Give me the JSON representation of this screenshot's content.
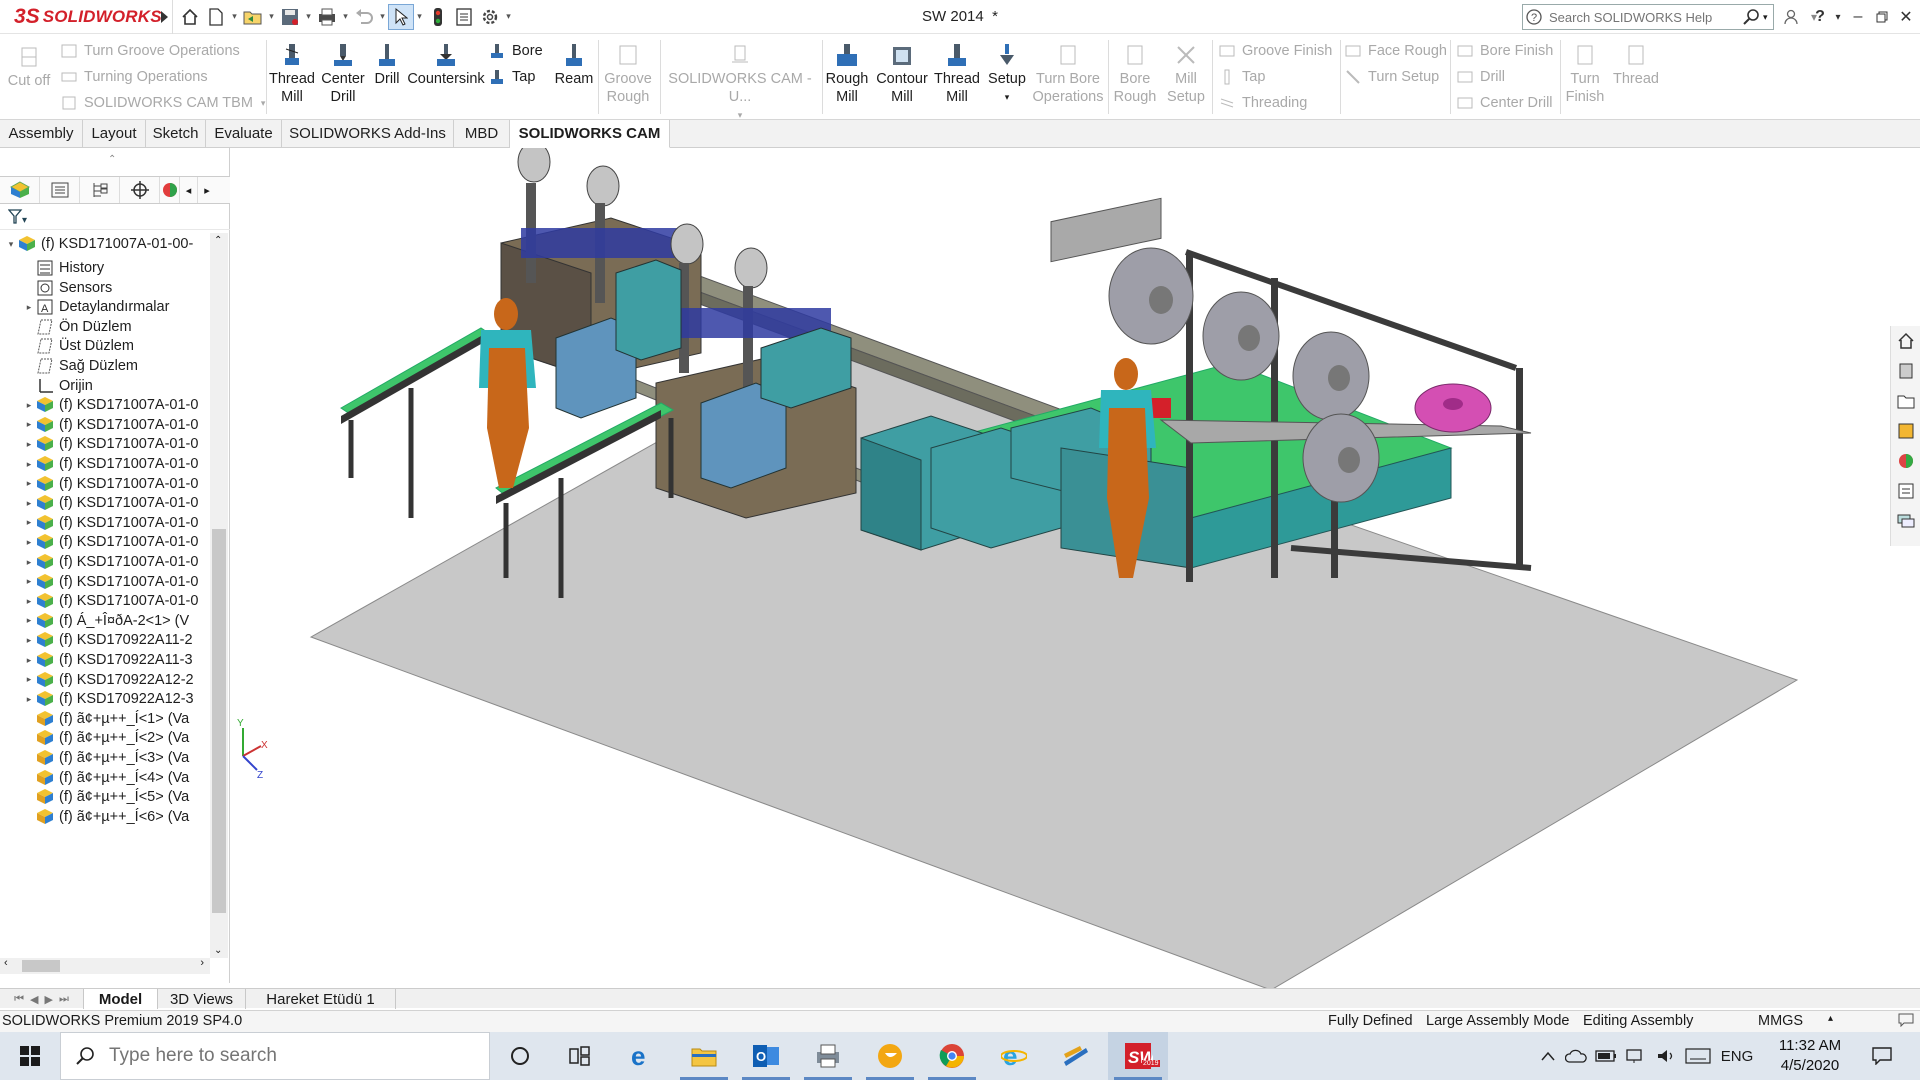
{
  "app": {
    "brand": "SOLIDWORKS",
    "document_title": "SW 2014",
    "modified_marker": "*",
    "search_placeholder": "Search SOLIDWORKS Help"
  },
  "ribbon": {
    "cut_off": "Cut off",
    "turn_groove_operations": "Turn Groove Operations",
    "turning_operations": "Turning Operations",
    "cam_tbm": "SOLIDWORKS CAM TBM",
    "thread_mill": [
      "Thread",
      "Mill"
    ],
    "center_drill": [
      "Center",
      "Drill"
    ],
    "drill": "Drill",
    "countersink": "Countersink",
    "bore": "Bore",
    "tap": "Tap",
    "ream": "Ream",
    "groove_rough": [
      "Groove",
      "Rough"
    ],
    "cam_u": "SOLIDWORKS CAM -U...",
    "rough_mill": [
      "Rough",
      "Mill"
    ],
    "contour_mill": [
      "Contour",
      "Mill"
    ],
    "thread_mill_2": [
      "Thread",
      "Mill"
    ],
    "setup": "Setup",
    "turn_bore_operations": [
      "Turn Bore",
      "Operations"
    ],
    "bore_rough": [
      "Bore",
      "Rough"
    ],
    "mill_setup": [
      "Mill",
      "Setup"
    ],
    "groove_finish": "Groove Finish",
    "tap_2": "Tap",
    "threading": "Threading",
    "face_rough": "Face Rough",
    "turn_setup": "Turn Setup",
    "bore_finish": "Bore Finish",
    "drill_2": "Drill",
    "center_drill_2": "Center Drill",
    "turn_finish": [
      "Turn",
      "Finish"
    ],
    "thread": "Thread"
  },
  "tabs": [
    "Assembly",
    "Layout",
    "Sketch",
    "Evaluate",
    "SOLIDWORKS Add-Ins",
    "MBD",
    "SOLIDWORKS CAM"
  ],
  "active_tab": "SOLIDWORKS CAM",
  "tree": {
    "root": "(f) KSD171007A-01-00-",
    "items": [
      {
        "label": "History",
        "icon": "history-icon",
        "expand": false
      },
      {
        "label": "Sensors",
        "icon": "sensors-icon",
        "expand": false
      },
      {
        "label": "Detaylandırmalar",
        "icon": "annotations-icon",
        "expand": true
      },
      {
        "label": "Ön Düzlem",
        "icon": "plane-icon",
        "expand": false
      },
      {
        "label": "Üst Düzlem",
        "icon": "plane-icon",
        "expand": false
      },
      {
        "label": "Sağ Düzlem",
        "icon": "plane-icon",
        "expand": false
      },
      {
        "label": "Orijin",
        "icon": "origin-icon",
        "expand": false
      },
      {
        "label": "(f) KSD171007A-01-0",
        "icon": "subassembly-icon",
        "expand": true
      },
      {
        "label": "(f) KSD171007A-01-0",
        "icon": "subassembly-icon",
        "expand": true
      },
      {
        "label": "(f) KSD171007A-01-0",
        "icon": "subassembly-icon",
        "expand": true
      },
      {
        "label": "(f) KSD171007A-01-0",
        "icon": "subassembly-icon",
        "expand": true
      },
      {
        "label": "(f) KSD171007A-01-0",
        "icon": "subassembly-icon",
        "expand": true
      },
      {
        "label": "(f) KSD171007A-01-0",
        "icon": "subassembly-icon",
        "expand": true
      },
      {
        "label": "(f) KSD171007A-01-0",
        "icon": "subassembly-icon",
        "expand": true
      },
      {
        "label": "(f) KSD171007A-01-0",
        "icon": "subassembly-icon",
        "expand": true
      },
      {
        "label": "(f) KSD171007A-01-0",
        "icon": "subassembly-icon",
        "expand": true
      },
      {
        "label": "(f) KSD171007A-01-0",
        "icon": "subassembly-icon",
        "expand": true
      },
      {
        "label": "(f) KSD171007A-01-0",
        "icon": "subassembly-icon",
        "expand": true
      },
      {
        "label": "(f) Á_+Î¤ðA-2<1> (V",
        "icon": "subassembly-icon",
        "expand": true
      },
      {
        "label": "(f) KSD170922A11-2",
        "icon": "subassembly-icon",
        "expand": true
      },
      {
        "label": "(f) KSD170922A11-3",
        "icon": "subassembly-icon",
        "expand": true
      },
      {
        "label": "(f) KSD170922A12-2",
        "icon": "subassembly-icon",
        "expand": true
      },
      {
        "label": "(f) KSD170922A12-3",
        "icon": "subassembly-icon",
        "expand": true
      },
      {
        "label": "(f) ã¢+µ++_Í<1> (Va",
        "icon": "part-icon",
        "expand": false
      },
      {
        "label": "(f) ã¢+µ++_Í<2> (Va",
        "icon": "part-icon",
        "expand": false
      },
      {
        "label": "(f) ã¢+µ++_Í<3> (Va",
        "icon": "part-icon",
        "expand": false
      },
      {
        "label": "(f) ã¢+µ++_Í<4> (Va",
        "icon": "part-icon",
        "expand": false
      },
      {
        "label": "(f) ã¢+µ++_Í<5> (Va",
        "icon": "part-icon",
        "expand": false
      },
      {
        "label": "(f) ã¢+µ++_Í<6> (Va",
        "icon": "part-icon",
        "expand": false
      }
    ]
  },
  "bottom_tabs": [
    "Model",
    "3D Views",
    "Hareket Etüdü 1"
  ],
  "active_bottom_tab": "Model",
  "status": {
    "product": "SOLIDWORKS Premium 2019 SP4.0",
    "fully_defined": "Fully Defined",
    "large_assembly": "Large Assembly Mode",
    "editing": "Editing Assembly",
    "units": "MMGS"
  },
  "taskbar": {
    "search_placeholder": "Type here to search",
    "language": "ENG",
    "time": "11:32 AM",
    "date": "4/5/2020",
    "sw_badge": "2019"
  },
  "colors": {
    "brand_red": "#d3202a",
    "machine_teal": "#3f9ea3",
    "conveyor_green": "#3ec66b",
    "floor_gray": "#c8c8c8",
    "worker_orange": "#c8671a",
    "worker_shirt": "#2fb5bd",
    "spool_gray": "#9e9ea8",
    "spool_magenta": "#d44fb3"
  }
}
